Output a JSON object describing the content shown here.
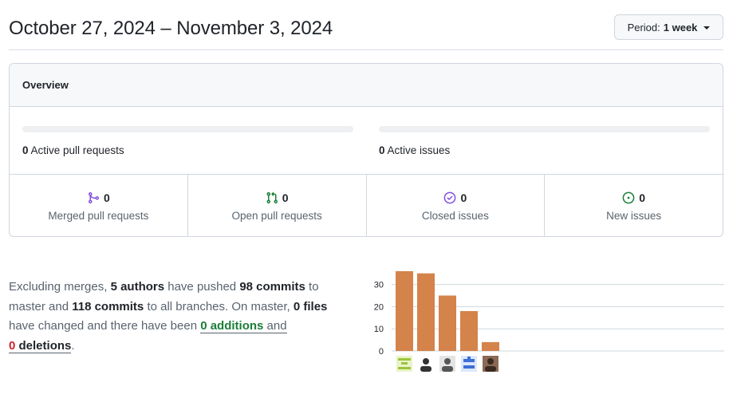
{
  "header": {
    "date_range": "October 27, 2024 – November 3, 2024",
    "period_prefix": "Period:",
    "period_value": "1 week"
  },
  "overview": {
    "title": "Overview",
    "active_pull_requests": {
      "count": "0",
      "label": "Active pull requests",
      "progress": 0
    },
    "active_issues": {
      "count": "0",
      "label": "Active issues",
      "progress": 0
    },
    "stats": [
      {
        "count": "0",
        "label": "Merged pull requests",
        "icon": "git-merge-icon",
        "color": "#8250df"
      },
      {
        "count": "0",
        "label": "Open pull requests",
        "icon": "git-pull-request-icon",
        "color": "#1a7f37"
      },
      {
        "count": "0",
        "label": "Closed issues",
        "icon": "issue-closed-icon",
        "color": "#8250df"
      },
      {
        "count": "0",
        "label": "New issues",
        "icon": "issue-opened-icon",
        "color": "#1a7f37"
      }
    ]
  },
  "summary": {
    "t1": "Excluding merges, ",
    "authors": "5 authors",
    "t2": " have pushed ",
    "commits": "98 commits",
    "t3": " to master and ",
    "all_commits": "118 commits",
    "t4": " to all branches. On master, ",
    "files": "0 files",
    "t5": " have changed and there have been ",
    "additions_num": "0",
    "additions_word": " additions",
    "t6": " and",
    "deletions_num": "0",
    "deletions_word": " deletions",
    "t7": "."
  },
  "chart_data": {
    "type": "bar",
    "categories": [
      "author-1",
      "author-2",
      "author-3",
      "author-4",
      "author-5"
    ],
    "values": [
      36,
      35,
      25,
      18,
      4
    ],
    "yticks": [
      0,
      10,
      20,
      30
    ],
    "ylim": [
      0,
      36
    ],
    "bar_color": "#d4834a",
    "title": "",
    "xlabel": "",
    "ylabel": ""
  }
}
